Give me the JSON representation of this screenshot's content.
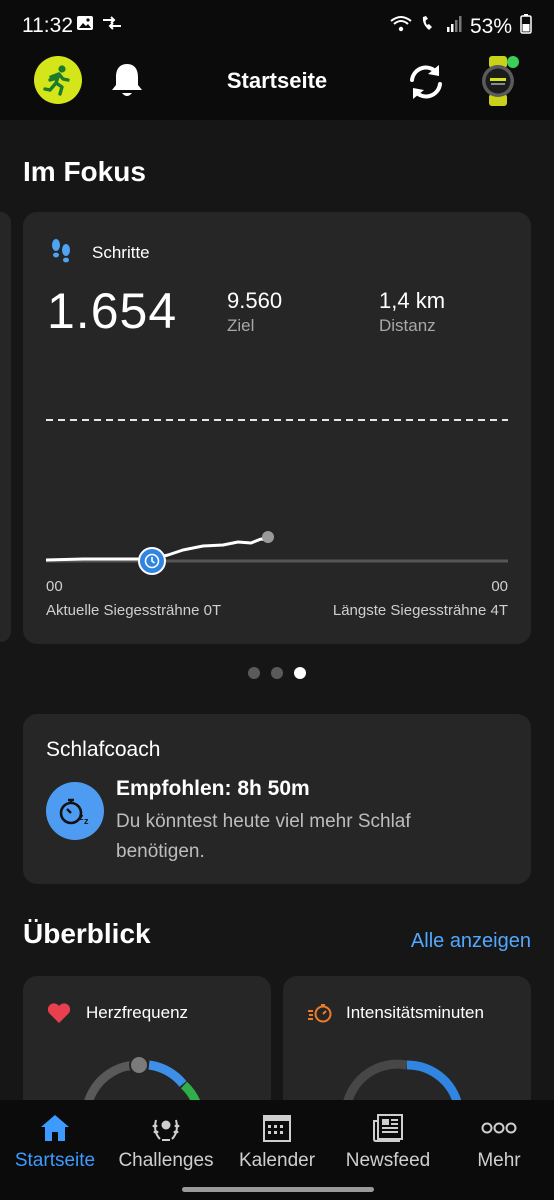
{
  "status_bar": {
    "time": "11:32",
    "battery": "53%",
    "icons": [
      "image-icon",
      "data-saver-icon",
      "wifi-calling-icon",
      "volte-icon",
      "signal-icon",
      "battery-icon"
    ]
  },
  "header": {
    "title": "Startseite",
    "icons": [
      "runner-avatar-icon",
      "bell-icon",
      "sync-icon",
      "watch-icon"
    ]
  },
  "focus": {
    "section_title": "Im Fokus",
    "card": {
      "label": "Schritte",
      "steps": "1.654",
      "goal_value": "9.560",
      "goal_label": "Ziel",
      "distance_value": "1,4 km",
      "distance_label": "Distanz",
      "axis_start": "00",
      "axis_end": "00",
      "current_streak": "Aktuelle Siegessträhne 0T",
      "longest_streak": "Längste Siegessträhne 4T",
      "progress_fraction": 0.173
    },
    "pager": {
      "count": 3,
      "active": 2
    }
  },
  "sleep_coach": {
    "title": "Schlafcoach",
    "headline": "Empfohlen: 8h 50m",
    "description": "Du könntest heute viel mehr Schlaf benötigen."
  },
  "overview": {
    "section_title": "Überblick",
    "see_all": "Alle anzeigen",
    "cards": [
      {
        "label": "Herzfrequenz",
        "icon": "heart-icon",
        "color": "#e8404f"
      },
      {
        "label": "Intensitätsminuten",
        "icon": "intensity-icon",
        "color": "#f07a2b"
      }
    ]
  },
  "bottom_nav": {
    "items": [
      {
        "label": "Startseite",
        "icon": "home-icon",
        "active": true
      },
      {
        "label": "Challenges",
        "icon": "laurel-icon",
        "active": false
      },
      {
        "label": "Kalender",
        "icon": "calendar-icon",
        "active": false
      },
      {
        "label": "Newsfeed",
        "icon": "newsfeed-icon",
        "active": false
      },
      {
        "label": "Mehr",
        "icon": "more-icon",
        "active": false
      }
    ]
  },
  "colors": {
    "accent": "#3d9bff",
    "card_bg": "#262626",
    "app_bg": "#161616",
    "avatar": "#d4e619",
    "sleep_icon_bg": "#4e9cf2"
  }
}
